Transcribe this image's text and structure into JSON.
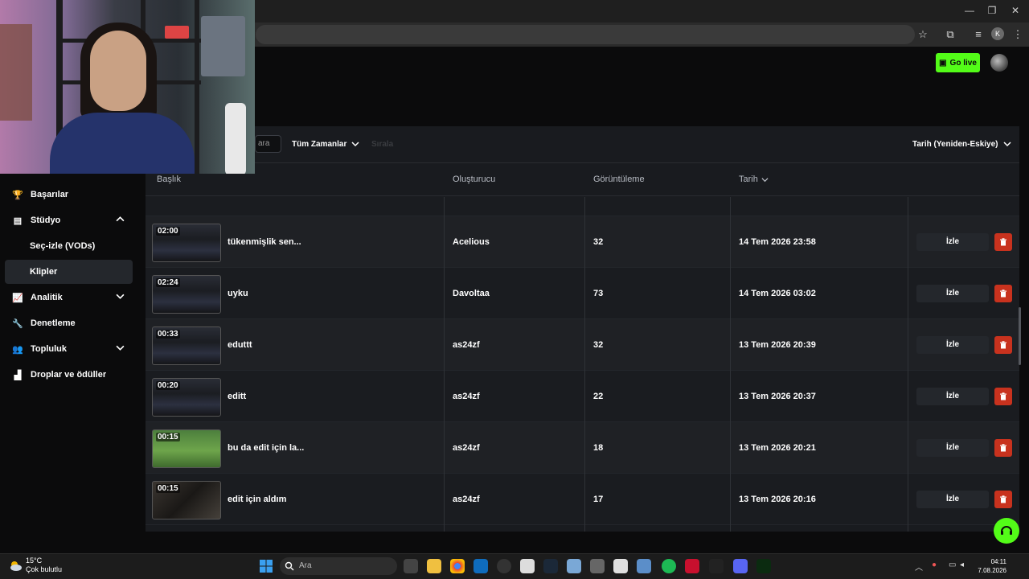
{
  "browser": {
    "profile_letter": "K"
  },
  "header": {
    "go_live_label": "Go live"
  },
  "filters": {
    "search_placeholder": "ara",
    "time_filter": "Tüm Zamanlar",
    "third_filter": "Sırala",
    "sort": "Tarih (Yeniden-Eskiye)"
  },
  "sidebar": {
    "items": [
      {
        "label": "Başarılar",
        "icon": "trophy-icon"
      },
      {
        "label": "Stüdyo",
        "icon": "studio-icon"
      },
      {
        "label": "Seç-izle (VODs)"
      },
      {
        "label": "Klipler"
      },
      {
        "label": "Analitik",
        "icon": "chart-icon"
      },
      {
        "label": "Denetleme",
        "icon": "wrench-icon"
      },
      {
        "label": "Topluluk",
        "icon": "community-icon"
      },
      {
        "label": "Droplar ve ödüller",
        "icon": "drops-icon"
      }
    ]
  },
  "table": {
    "columns": [
      "Başlık",
      "Oluşturucu",
      "Görüntüleme",
      "Tarih"
    ],
    "watch_label": "İzle",
    "rows": [
      {
        "duration": "02:00",
        "title": "tükenmişlik sen...",
        "creator": "Acelious",
        "views": "32",
        "date": "14 Tem 2026 23:58",
        "thumb": "code"
      },
      {
        "duration": "02:24",
        "title": "uyku",
        "creator": "Davoltaa",
        "views": "73",
        "date": "14 Tem 2026 03:02",
        "thumb": "code"
      },
      {
        "duration": "00:33",
        "title": "eduttt",
        "creator": "as24zf",
        "views": "32",
        "date": "13 Tem 2026 20:39",
        "thumb": "code"
      },
      {
        "duration": "00:20",
        "title": "editt",
        "creator": "as24zf",
        "views": "22",
        "date": "13 Tem 2026 20:37",
        "thumb": "code"
      },
      {
        "duration": "00:15",
        "title": "bu da edit için la...",
        "creator": "as24zf",
        "views": "18",
        "date": "13 Tem 2026 20:21",
        "thumb": "game"
      },
      {
        "duration": "00:15",
        "title": "edit için aldım",
        "creator": "as24zf",
        "views": "17",
        "date": "13 Tem 2026 20:16",
        "thumb": "dark"
      }
    ]
  },
  "taskbar": {
    "temperature": "15°C",
    "weather": "Çok bulutlu",
    "search_label": "Ara",
    "time": "04:11",
    "date": "7.08.2026"
  },
  "colors": {
    "accent": "#53fc18",
    "delete": "#c8321e",
    "panel": "#191b1f"
  }
}
